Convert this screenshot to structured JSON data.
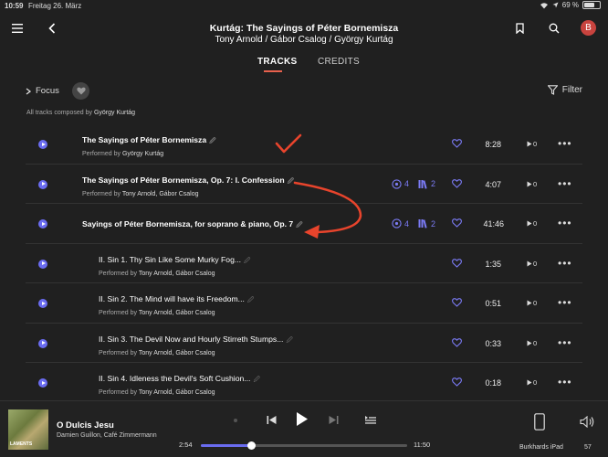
{
  "status": {
    "time": "10:59",
    "date": "Freitag 26. März",
    "battery": "69 %",
    "battery_level": 0.69
  },
  "header": {
    "title": "Kurtág: The Sayings of Péter Bornemisza",
    "subtitle": "Tony Arnold / Gábor Csalog / György Kurtág",
    "avatar": "B"
  },
  "tabs": [
    {
      "label": "TRACKS",
      "active": true
    },
    {
      "label": "CREDITS",
      "active": false
    }
  ],
  "filterbar": {
    "focus_label": "Focus",
    "filter_label": "Filter"
  },
  "composer_note": {
    "prefix": "All tracks composed by",
    "name": "György Kurtág"
  },
  "tracks": [
    {
      "title": "The Sayings of Péter Bornemisza",
      "performed_label": "Performed by",
      "performers": "György Kurtág",
      "duration": "8:28",
      "plays": "0",
      "indent": false,
      "badges": null
    },
    {
      "title": "The Sayings of Péter Bornemisza, Op. 7: I. Confession",
      "performed_label": "Performed by",
      "performers": "Tony Arnold, Gábor Csalog",
      "duration": "4:07",
      "plays": "0",
      "indent": false,
      "badges": {
        "versions": "4",
        "albums": "2"
      }
    },
    {
      "title": "Sayings of Péter Bornemisza, for soprano & piano, Op. 7",
      "performed_label": "",
      "performers": "",
      "duration": "41:46",
      "plays": "0",
      "indent": false,
      "badges": {
        "versions": "4",
        "albums": "2"
      }
    },
    {
      "title": "II. Sin 1. Thy Sin Like Some Murky Fog...",
      "performed_label": "Performed by",
      "performers": "Tony Arnold, Gábor Csalog",
      "duration": "1:35",
      "plays": "0",
      "indent": true,
      "badges": null
    },
    {
      "title": "II. Sin 2. The Mind will have its Freedom...",
      "performed_label": "Performed by",
      "performers": "Tony Arnold, Gábor Csalog",
      "duration": "0:51",
      "plays": "0",
      "indent": true,
      "badges": null
    },
    {
      "title": "II. Sin 3. The Devil Now and Hourly Stirreth Stumps...",
      "performed_label": "Performed by",
      "performers": "Tony Arnold, Gábor Csalog",
      "duration": "0:33",
      "plays": "0",
      "indent": true,
      "badges": null
    },
    {
      "title": "II. Sin 4. Idleness the Devil's Soft Cushion...",
      "performed_label": "Performed by",
      "performers": "Tony Arnold, Gábor Csalog",
      "duration": "0:18",
      "plays": "0",
      "indent": true,
      "badges": null
    }
  ],
  "player": {
    "cover_label": "LAMENTS",
    "title": "O Dulcis Jesu",
    "artists": "Damien Guillon, Café Zimmermann",
    "elapsed": "2:54",
    "total": "11:50",
    "progress": 0.245,
    "device": "Burkhards iPad",
    "volume": "57"
  },
  "colors": {
    "accent": "#6a6cf0",
    "tab_underline": "#e8614d",
    "annotation": "#e8442c"
  }
}
